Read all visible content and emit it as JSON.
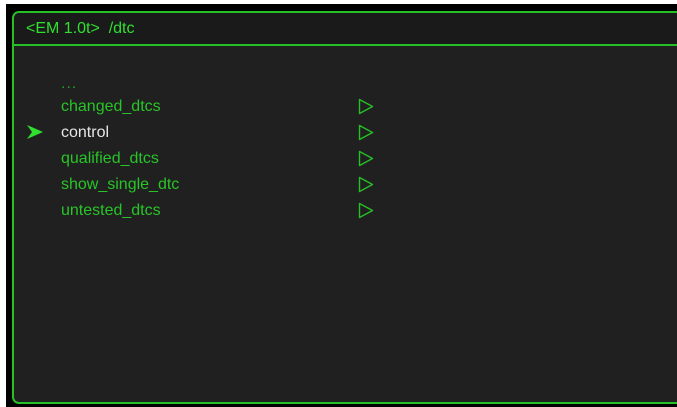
{
  "header": {
    "title": "<EM 1.0t>  /dtc"
  },
  "menu": {
    "parent_label": "...",
    "selected_index": 1,
    "items": [
      {
        "label": "changed_dtcs",
        "has_submenu": true
      },
      {
        "label": "control",
        "has_submenu": true
      },
      {
        "label": "qualified_dtcs",
        "has_submenu": true
      },
      {
        "label": "show_single_dtc",
        "has_submenu": true
      },
      {
        "label": "untested_dtcs",
        "has_submenu": true
      }
    ]
  },
  "colors": {
    "accent_green": "#25c025",
    "text_green": "#28c428",
    "selected_text": "#e6e6e6",
    "background": "#202020"
  },
  "icons": {
    "selector": "selector-arrow-icon",
    "submenu": "submenu-arrow-icon"
  }
}
